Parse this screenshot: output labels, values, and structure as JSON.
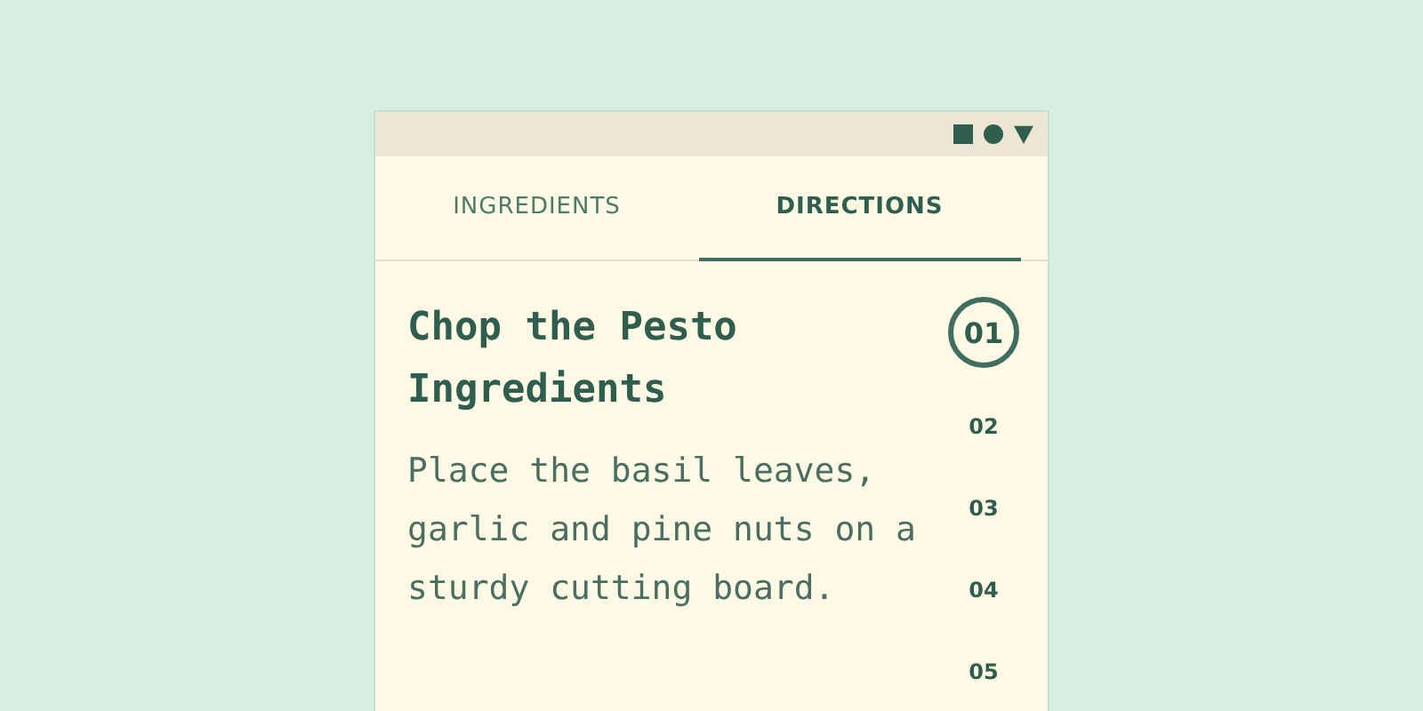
{
  "window": {
    "controls": [
      {
        "kind": "square"
      },
      {
        "kind": "circle"
      },
      {
        "kind": "triangle"
      }
    ]
  },
  "tabs": [
    {
      "label": "INGREDIENTS",
      "selected": false
    },
    {
      "label": "DIRECTIONS",
      "selected": true
    }
  ],
  "step": {
    "title": "Chop the Pesto Ingredients",
    "text": "Place the basil leaves, garlic and pine nuts on a sturdy cutting board."
  },
  "steps": [
    {
      "label": "01",
      "selected": true
    },
    {
      "label": "02",
      "selected": false
    },
    {
      "label": "03",
      "selected": false
    },
    {
      "label": "04",
      "selected": false
    },
    {
      "label": "05",
      "selected": false
    }
  ]
}
